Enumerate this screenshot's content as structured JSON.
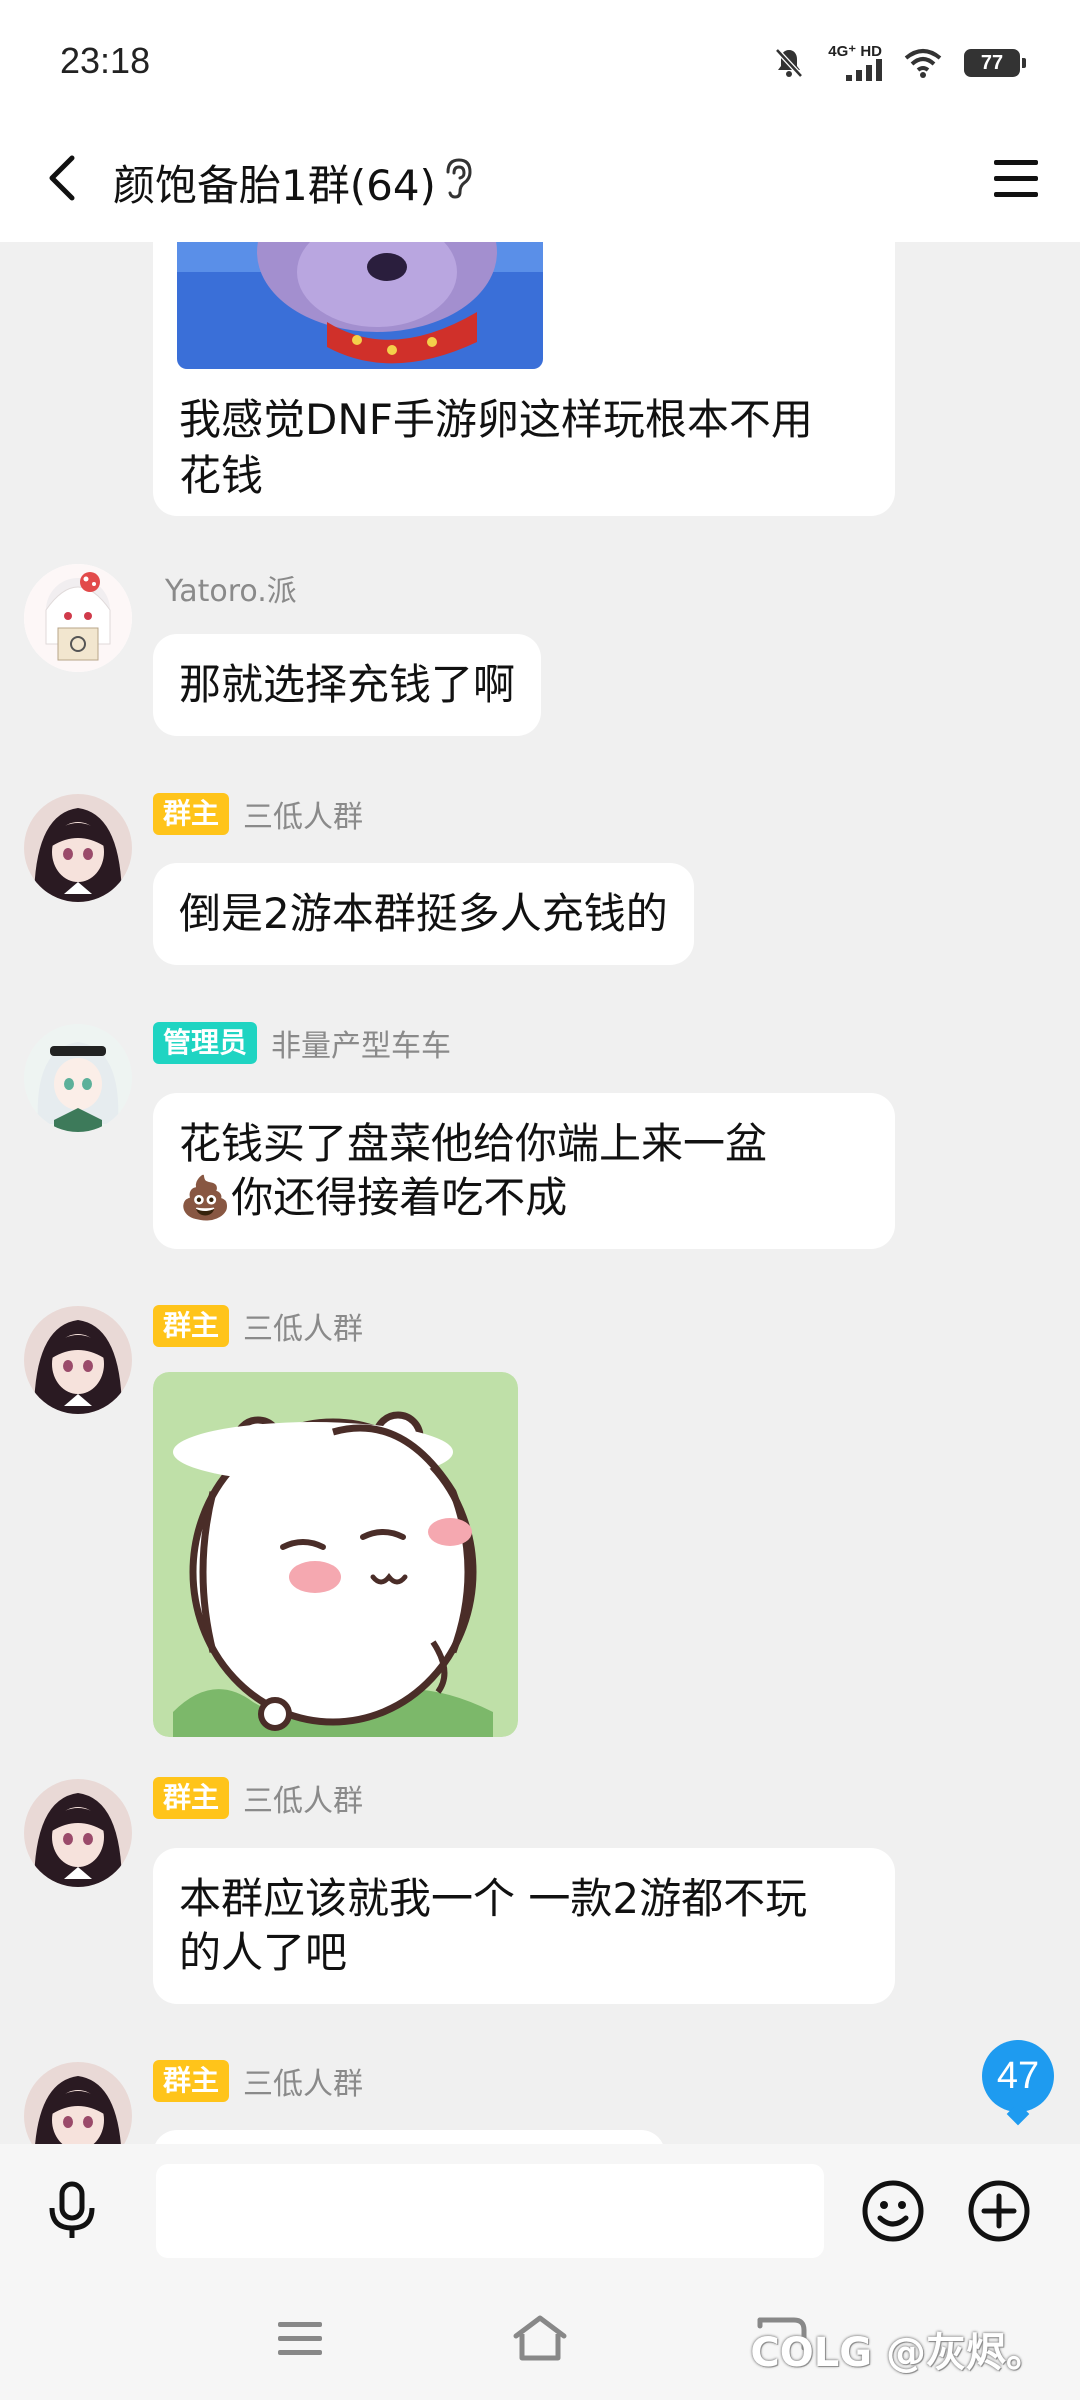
{
  "status_bar": {
    "time": "23:18",
    "network_label": "4G⁺ HD",
    "battery": "77"
  },
  "header": {
    "title": "颜饱备胎1群(64)"
  },
  "messages": [
    {
      "sender": "",
      "role": "",
      "text": "我感觉DNF手游卵这样玩根本不用\n花钱",
      "image": "sticker-dog-cropped"
    },
    {
      "sender": "Yatoro.派",
      "role": "",
      "text": "那就选择充钱了啊"
    },
    {
      "sender": "三低人群",
      "role": "群主",
      "text": "倒是2游本群挺多人充钱的"
    },
    {
      "sender": "非量产型车车",
      "role": "管理员",
      "text": "花钱买了盘菜他给你端上来一盆\n💩你还得接着吃不成"
    },
    {
      "sender": "三低人群",
      "role": "群主",
      "text": "",
      "image": "sticker-white-hamster"
    },
    {
      "sender": "三低人群",
      "role": "群主",
      "text": "本群应该就我一个 一款2游都不玩\n的人了吧"
    },
    {
      "sender": "三低人群",
      "role": "群主",
      "text": ""
    }
  ],
  "unread_count": "47",
  "input": {
    "placeholder": ""
  },
  "watermark": "COLG @灰烬。",
  "colors": {
    "owner_badge": "#ffc41a",
    "admin_badge": "#1fd4c2",
    "unread_badge": "#1e9bf0",
    "chat_background": "#f0f0f0"
  }
}
